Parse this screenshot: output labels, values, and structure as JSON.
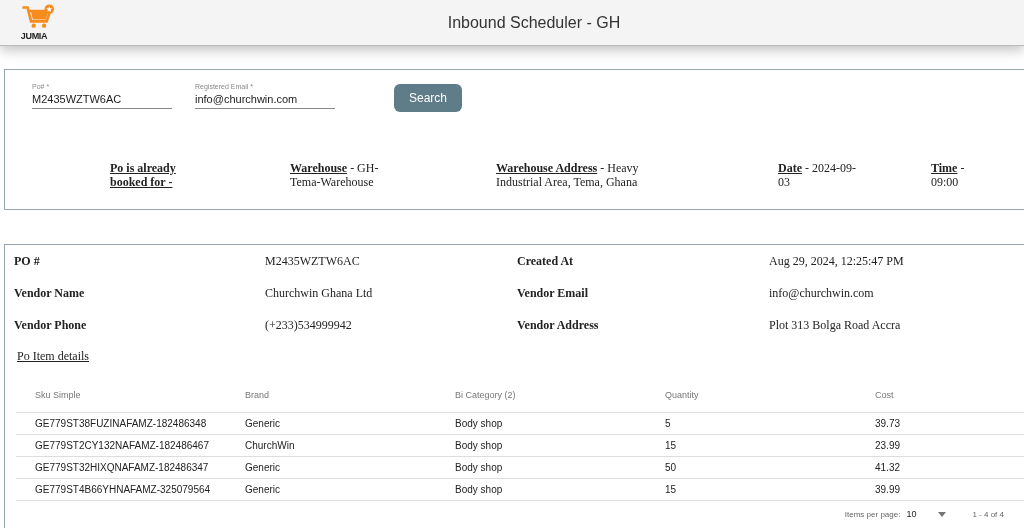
{
  "header": {
    "logo_text": "JUMIA",
    "title": "Inbound Scheduler - GH"
  },
  "search_form": {
    "fields": [
      {
        "label": "Po# *",
        "value": "M2435WZTW6AC"
      },
      {
        "label": "Registered Email *",
        "value": "info@churchwin.com"
      }
    ],
    "button": "Search"
  },
  "booking": [
    {
      "label": "Po is already booked for -"
    },
    {
      "label": "Warehouse",
      "value": "- GH-Tema-Warehouse"
    },
    {
      "label": "Warehouse Address",
      "value": "- Heavy Industrial Area, Tema, Ghana"
    },
    {
      "label": "Date",
      "value": "- 2024-09-03"
    },
    {
      "label": "Time",
      "value": "- 09:00"
    }
  ],
  "po_details": [
    {
      "label": "PO #",
      "value": "M2435WZTW6AC"
    },
    {
      "label": "Created At",
      "value": "Aug 29, 2024, 12:25:47 PM"
    },
    {
      "label": "Vendor Name",
      "value": "Churchwin Ghana Ltd"
    },
    {
      "label": "Vendor Email",
      "value": "info@churchwin.com"
    },
    {
      "label": "Vendor Phone",
      "value": "(+233)534999942"
    },
    {
      "label": "Vendor Address",
      "value": "Plot 313 Bolga Road Accra"
    }
  ],
  "items_link": "Po Item details",
  "table": {
    "columns": [
      "Sku Simple",
      "Brand",
      "Bi Category (2)",
      "Quantity",
      "Cost"
    ],
    "rows": [
      [
        "GE779ST38FUZINAFAMZ-182486348",
        "Generic",
        "Body shop",
        "5",
        "39.73"
      ],
      [
        "GE779ST2CY132NAFAMZ-182486467",
        "ChurchWin",
        "Body shop",
        "15",
        "23.99"
      ],
      [
        "GE779ST32HIXQNAFAMZ-182486347",
        "Generic",
        "Body shop",
        "50",
        "41.32"
      ],
      [
        "GE779ST4B66YHNAFAMZ-325079564",
        "Generic",
        "Body shop",
        "15",
        "39.99"
      ]
    ]
  },
  "paginator": {
    "label": "Items per page:",
    "page_size": "10",
    "range": "1 - 4 of 4"
  }
}
